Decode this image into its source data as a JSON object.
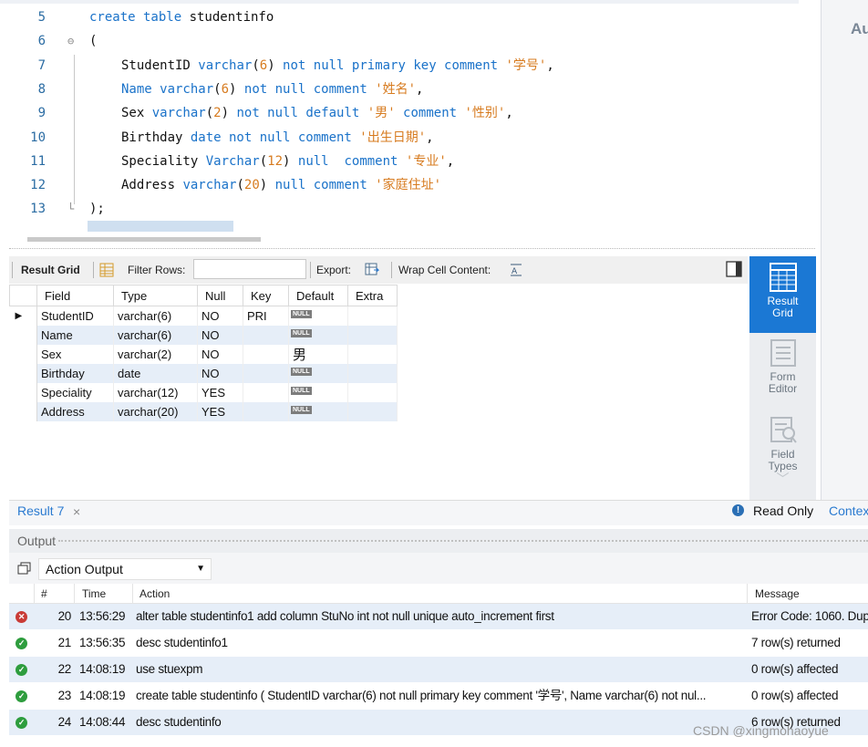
{
  "editor": {
    "lines": [
      {
        "num": "5",
        "tokens": [
          [
            "kw",
            "create table "
          ],
          [
            "plain",
            "studentinfo"
          ]
        ]
      },
      {
        "num": "6",
        "fold": "⊖",
        "tokens": [
          [
            "plain",
            "("
          ]
        ]
      },
      {
        "num": "7",
        "indent": true,
        "tokens": [
          [
            "plain",
            "StudentID "
          ],
          [
            "kw",
            "varchar"
          ],
          [
            "plain",
            "("
          ],
          [
            "num",
            "6"
          ],
          [
            "plain",
            ") "
          ],
          [
            "kw",
            "not null primary key comment "
          ],
          [
            "str",
            "'学号'"
          ],
          [
            "plain",
            ","
          ]
        ]
      },
      {
        "num": "8",
        "indent": true,
        "tokens": [
          [
            "kw",
            "Name varchar"
          ],
          [
            "plain",
            "("
          ],
          [
            "num",
            "6"
          ],
          [
            "plain",
            ") "
          ],
          [
            "kw",
            "not null comment "
          ],
          [
            "str",
            "'姓名'"
          ],
          [
            "plain",
            ","
          ]
        ]
      },
      {
        "num": "9",
        "indent": true,
        "tokens": [
          [
            "plain",
            "Sex "
          ],
          [
            "kw",
            "varchar"
          ],
          [
            "plain",
            "("
          ],
          [
            "num",
            "2"
          ],
          [
            "plain",
            ") "
          ],
          [
            "kw",
            "not null default "
          ],
          [
            "str",
            "'男'"
          ],
          [
            "kw",
            " comment "
          ],
          [
            "str",
            "'性别'"
          ],
          [
            "plain",
            ","
          ]
        ]
      },
      {
        "num": "10",
        "indent": true,
        "tokens": [
          [
            "plain",
            "Birthday "
          ],
          [
            "kw",
            "date not null comment "
          ],
          [
            "str",
            "'出生日期'"
          ],
          [
            "plain",
            ","
          ]
        ]
      },
      {
        "num": "11",
        "indent": true,
        "tokens": [
          [
            "plain",
            "Speciality "
          ],
          [
            "kw",
            "Varchar"
          ],
          [
            "plain",
            "("
          ],
          [
            "num",
            "12"
          ],
          [
            "plain",
            ") "
          ],
          [
            "kw",
            "null  comment "
          ],
          [
            "str",
            "'专业'"
          ],
          [
            "plain",
            ","
          ]
        ]
      },
      {
        "num": "12",
        "indent": true,
        "tokens": [
          [
            "plain",
            "Address "
          ],
          [
            "kw",
            "varchar"
          ],
          [
            "plain",
            "("
          ],
          [
            "num",
            "20"
          ],
          [
            "plain",
            ") "
          ],
          [
            "kw",
            "null comment "
          ],
          [
            "str",
            "'家庭住址'"
          ]
        ]
      },
      {
        "num": "13",
        "fold": "└",
        "tokens": [
          [
            "plain",
            ");"
          ]
        ]
      }
    ]
  },
  "right_panel_label": "Au",
  "toolbar": {
    "result_grid": "Result Grid",
    "filter_rows": "Filter Rows:",
    "export": "Export:",
    "wrap": "Wrap Cell Content:"
  },
  "grid": {
    "columns": [
      "Field",
      "Type",
      "Null",
      "Key",
      "Default",
      "Extra"
    ],
    "rows": [
      {
        "field": "StudentID",
        "type": "varchar(6)",
        "null": "NO",
        "key": "PRI",
        "default": "NULL",
        "extra": ""
      },
      {
        "field": "Name",
        "type": "varchar(6)",
        "null": "NO",
        "key": "",
        "default": "NULL",
        "extra": ""
      },
      {
        "field": "Sex",
        "type": "varchar(2)",
        "null": "NO",
        "key": "",
        "default": "男",
        "extra": ""
      },
      {
        "field": "Birthday",
        "type": "date",
        "null": "NO",
        "key": "",
        "default": "NULL",
        "extra": ""
      },
      {
        "field": "Speciality",
        "type": "varchar(12)",
        "null": "YES",
        "key": "",
        "default": "NULL",
        "extra": ""
      },
      {
        "field": "Address",
        "type": "varchar(20)",
        "null": "YES",
        "key": "",
        "default": "NULL",
        "extra": ""
      }
    ]
  },
  "sidebar": {
    "result_grid_1": "Result",
    "result_grid_2": "Grid",
    "form_editor_1": "Form",
    "form_editor_2": "Editor",
    "field_types_1": "Field",
    "field_types_2": "Types"
  },
  "result_tabs": {
    "tab": "Result 7",
    "close": "×",
    "read_only": "Read Only",
    "context": "Contex"
  },
  "output": {
    "title": "Output",
    "selector": "Action Output",
    "columns": {
      "num": "#",
      "time": "Time",
      "action": "Action",
      "message": "Message"
    },
    "rows": [
      {
        "status": "error",
        "num": "20",
        "time": "13:56:29",
        "action": "alter table studentinfo1 add column StuNo int not null unique auto_increment first",
        "message": "Error Code: 1060. Dup"
      },
      {
        "status": "ok",
        "num": "21",
        "time": "13:56:35",
        "action": "desc studentinfo1",
        "message": "7 row(s) returned"
      },
      {
        "status": "ok",
        "num": "22",
        "time": "14:08:19",
        "action": "use stuexpm",
        "message": "0 row(s) affected"
      },
      {
        "status": "ok",
        "num": "23",
        "time": "14:08:19",
        "action": "create table studentinfo ( StudentID varchar(6) not null primary key comment '学号',      Name varchar(6) not nul...",
        "message": "0 row(s) affected"
      },
      {
        "status": "ok",
        "num": "24",
        "time": "14:08:44",
        "action": "desc studentinfo",
        "message": "6 row(s) returned"
      }
    ]
  },
  "watermark": "CSDN @xingmohaoyue",
  "colors": {
    "keyword": "#1a72c9",
    "string": "#d77b1f",
    "accent": "#1b78d4",
    "ok": "#2e9d3e",
    "error": "#c93b36"
  }
}
